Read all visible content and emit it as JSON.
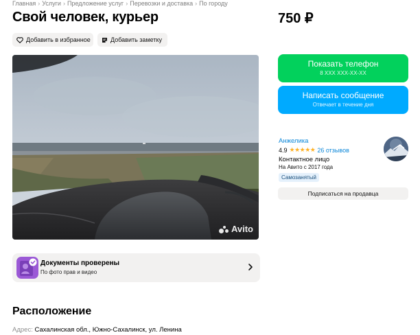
{
  "breadcrumbs": [
    "Главная",
    "Услуги",
    "Предложение услуг",
    "Перевозки и доставка",
    "По городу"
  ],
  "listing": {
    "title": "Свой человек, курьер",
    "price": "750 ₽"
  },
  "actions": {
    "favorite_label": "Добавить в избранное",
    "note_label": "Добавить заметку"
  },
  "photo": {
    "watermark": "Avito"
  },
  "contact": {
    "phone_label": "Показать телефон",
    "phone_masked": "8 XXX XXX-XX-XX",
    "message_label": "Написать сообщение",
    "message_sub": "Отвечает в течение дня"
  },
  "seller": {
    "name": "Анжелика",
    "rating": "4.9",
    "stars": 5,
    "reviews": "26 отзывов",
    "type": "Контактное лицо",
    "since": "На Авито с 2017 года",
    "badge": "Самозанятый",
    "subscribe_label": "Подписаться на продавца"
  },
  "documents": {
    "title": "Документы проверены",
    "subtitle": "По фото прав и видео"
  },
  "location": {
    "heading": "Расположение",
    "address_label": "Адрес:",
    "address_value": "Сахалинская обл., Южно-Сахалинск, ул. Ленина"
  },
  "colors": {
    "green": "#02d15c",
    "blue": "#00aaff",
    "link": "#0a86d8",
    "star": "#ffb021",
    "chip_bg": "#f2f1f0"
  },
  "icons": {
    "favorite": "heart-icon",
    "note": "note-icon",
    "chevron": "chevron-right-icon",
    "documents": "verified-document-icon"
  }
}
